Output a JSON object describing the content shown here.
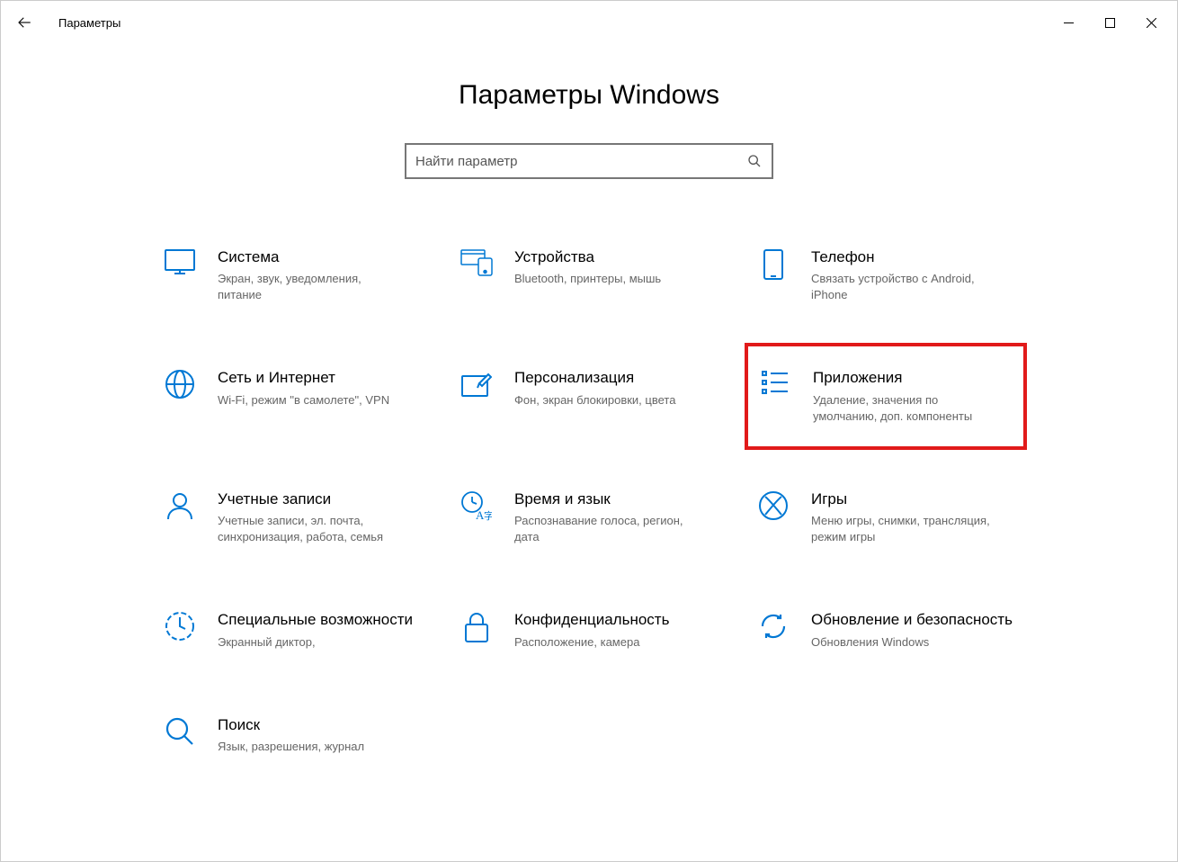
{
  "titlebar": {
    "label": "Параметры"
  },
  "heading": "Параметры Windows",
  "search": {
    "placeholder": "Найти параметр"
  },
  "tiles": [
    {
      "title": "Система",
      "desc": "Экран, звук, уведомления, питание"
    },
    {
      "title": "Устройства",
      "desc": "Bluetooth, принтеры, мышь"
    },
    {
      "title": "Телефон",
      "desc": "Связать устройство с Android, iPhone"
    },
    {
      "title": "Сеть и Интернет",
      "desc": "Wi-Fi, режим \"в самолете\", VPN"
    },
    {
      "title": "Персонализация",
      "desc": "Фон, экран блокировки, цвета"
    },
    {
      "title": "Приложения",
      "desc": "Удаление, значения по умолчанию, доп. компоненты"
    },
    {
      "title": "Учетные записи",
      "desc": "Учетные записи, эл. почта, синхронизация, работа, семья"
    },
    {
      "title": "Время и язык",
      "desc": "Распознавание голоса, регион, дата"
    },
    {
      "title": "Игры",
      "desc": "Меню игры, снимки, трансляция, режим игры"
    },
    {
      "title": "Специальные возможности",
      "desc": "Экранный диктор,"
    },
    {
      "title": "Конфиденциальность",
      "desc": "Расположение, камера"
    },
    {
      "title": "Обновление и безопасность",
      "desc": "Обновления Windows"
    },
    {
      "title": "Поиск",
      "desc": "Язык, разрешения, журнал"
    }
  ],
  "highlighted_index": 5,
  "colors": {
    "accent": "#0078d4",
    "highlight": "#e11a1a"
  }
}
